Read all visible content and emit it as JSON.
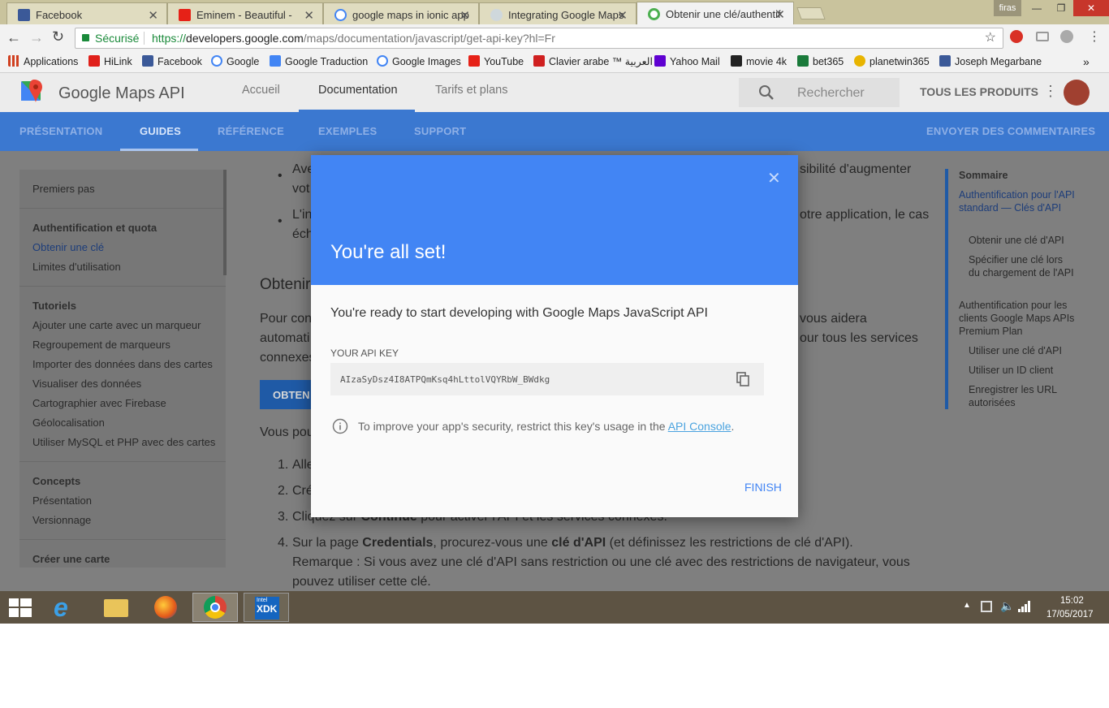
{
  "browser": {
    "tabs": [
      {
        "title": "Facebook",
        "fav_color": "#3b5998"
      },
      {
        "title": "Eminem - Beautiful - ",
        "fav_color": "#e62117"
      },
      {
        "title": "google maps in ionic app",
        "fav_color": "#4285f4"
      },
      {
        "title": "Integrating Google Maps",
        "fav_color": "#9aa"
      },
      {
        "title": "Obtenir une clé/authentif",
        "fav_color": "#4caf50"
      }
    ],
    "user": "firas",
    "secure_label": "Sécurisé",
    "url_scheme": "https://",
    "url_host": "developers.google.com",
    "url_path": "/maps/documentation/javascript/get-api-key?hl=Fr",
    "bookmarks": [
      {
        "label": "Applications",
        "color": "#d04020"
      },
      {
        "label": "HiLink",
        "color": "#e0201a"
      },
      {
        "label": "Facebook",
        "color": "#3b5998"
      },
      {
        "label": "Google",
        "color": "#4285f4"
      },
      {
        "label": "Google Traduction",
        "color": "#4285f4"
      },
      {
        "label": "Google Images",
        "color": "#4285f4"
      },
      {
        "label": "YouTube",
        "color": "#e62117"
      },
      {
        "label": "Clavier arabe ™ العربية",
        "color": "#d02020"
      },
      {
        "label": "Yahoo Mail",
        "color": "#5f01d1"
      },
      {
        "label": "movie 4k",
        "color": "#222"
      },
      {
        "label": "bet365",
        "color": "#1a7a3a"
      },
      {
        "label": "planetwin365",
        "color": "#e8b400"
      },
      {
        "label": "Joseph Megarbane",
        "color": "#3b5998"
      }
    ],
    "more": "»"
  },
  "site": {
    "product": "Google Maps API",
    "nav": [
      "Accueil",
      "Documentation",
      "Tarifs et plans"
    ],
    "search_placeholder": "Rechercher",
    "all_products": "TOUS LES PRODUITS",
    "subnav": [
      "PRÉSENTATION",
      "GUIDES",
      "RÉFÉRENCE",
      "EXEMPLES",
      "SUPPORT"
    ],
    "feedback": "ENVOYER DES COMMENTAIRES"
  },
  "sidebar": {
    "first": "Premiers pas",
    "auth_header": "Authentification et quota",
    "auth_items": [
      "Obtenir une clé",
      "Limites d'utilisation"
    ],
    "tut_header": "Tutoriels",
    "tut_items": [
      "Ajouter une carte avec un marqueur",
      "Regroupement de marqueurs",
      "Importer des données dans des cartes",
      "Visualiser des données",
      "Cartographier avec Firebase",
      "Géolocalisation",
      "Utiliser MySQL et PHP avec des cartes"
    ],
    "concepts_header": "Concepts",
    "concepts_items": [
      "Présentation",
      "Versionnage"
    ],
    "create_header": "Créer une carte"
  },
  "main": {
    "b1a": "Ave",
    "b1b": "sibilité d'augmenter",
    "b1c": "vot",
    "b2a": "L'in",
    "b2b": "otre application, le cas",
    "b2c": "éch",
    "heading": "Obtenir",
    "p1a": "Pour con",
    "p1b": "vous aidera",
    "p2a": "automati",
    "p2b": "our tous les services",
    "p3a": "connexes",
    "button": "OBTEN",
    "p4": "Vous pou",
    "s1": "Alle",
    "s2": "Cré",
    "s3a": "Cliquez sur ",
    "s3b": "Continue",
    "s3c": " pour activer l'API et les services connexes.",
    "s4a": "Sur la page ",
    "s4b": "Credentials",
    "s4c": ", procurez-vous une ",
    "s4d": "clé d'API",
    "s4e": " (et définissez les restrictions de clé d'API).",
    "s4f": "Remarque : Si vous avez une clé d'API sans restriction ou une clé avec des restrictions de navigateur, vous",
    "s4g": "pouvez utiliser cette clé.",
    "n1": "1.",
    "n2": "2.",
    "n3": "3.",
    "n4": "4."
  },
  "toc": {
    "title": "Sommaire",
    "items": [
      "Authentification pour l'API standard — Clés d'API",
      "Obtenir une clé d'API",
      "Spécifier une clé lors du chargement de l'API",
      "Authentification pour les clients Google Maps APIs Premium Plan",
      "Utiliser une clé d'API",
      "Utiliser un ID client",
      "Enregistrer les URL autorisées"
    ]
  },
  "modal": {
    "title": "You're all set!",
    "message": "You're ready to start developing with Google Maps JavaScript API",
    "key_label": "YOUR API KEY",
    "key": "AIzaSyDsz4I8ATPQmKsq4hLttolVQYRbW_BWdkg",
    "info_text": "To improve your app's security, restrict this key's usage in the ",
    "info_link": "API Console",
    "info_end": ".",
    "finish": "FINISH"
  },
  "taskbar": {
    "time": "15:02",
    "date": "17/05/2017",
    "xdk_small": "Intel",
    "xdk": "XDK"
  }
}
